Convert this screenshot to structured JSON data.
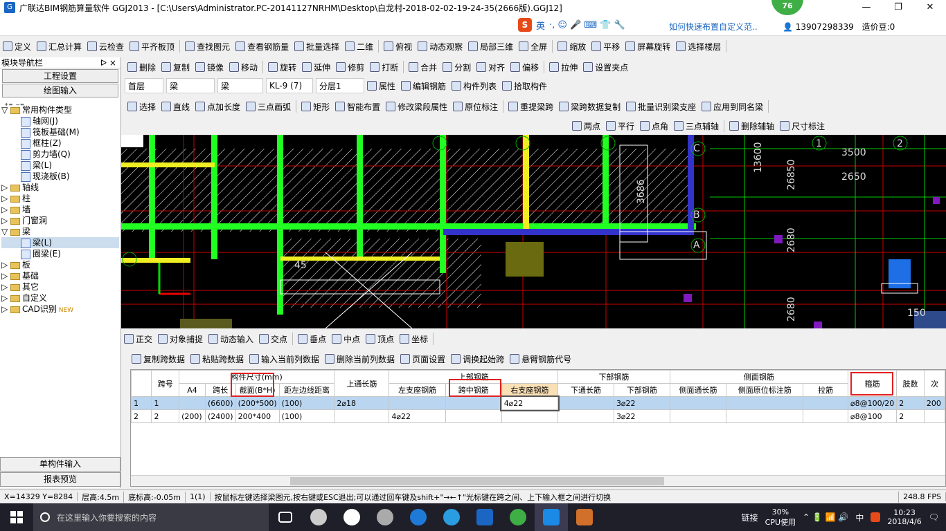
{
  "window": {
    "app_icon": "G",
    "title": "广联达BIM钢筋算量软件 GGJ2013 - [C:\\Users\\Administrator.PC-20141127NRHM\\Desktop\\白龙村-2018-02-02-19-24-35(2666版).GGJ12]",
    "badge": "76",
    "min": "—",
    "max": "❐",
    "close": "✕"
  },
  "ime": {
    "logo": "S",
    "lang": "英",
    "sym": "·, ☺ 🎤 ⌨ 👕 🔧"
  },
  "header": {
    "help_link": "如何快速布置自定义范..",
    "phone": "13907298339",
    "price": "造价豆:0"
  },
  "toolbar1": [
    "定义",
    "汇总计算",
    "云检查",
    "平齐板顶",
    "查找图元",
    "查看钢筋量",
    "批量选择",
    "二维",
    "俯视",
    "动态观察",
    "局部三维",
    "全屏",
    "缩放",
    "平移",
    "屏幕旋转",
    "选择楼层"
  ],
  "toolbar2": [
    "删除",
    "复制",
    "镜像",
    "移动",
    "旋转",
    "延伸",
    "修剪",
    "打断",
    "合并",
    "分割",
    "对齐",
    "偏移",
    "拉伸",
    "设置夹点"
  ],
  "toolbar3": {
    "floor": "首层",
    "cat": "梁",
    "type": "梁",
    "name": "KL-9 (7)",
    "layer": "分层1",
    "btns": [
      "属性",
      "编辑钢筋",
      "构件列表",
      "拾取构件"
    ]
  },
  "toolbar4": [
    "选择",
    "直线",
    "点加长度",
    "三点画弧",
    "矩形",
    "智能布置",
    "修改梁段属性",
    "原位标注",
    "重提梁跨",
    "梁跨数据复制",
    "批量识别梁支座",
    "应用到同名梁"
  ],
  "toolbar5": [
    "两点",
    "平行",
    "点角",
    "三点辅轴",
    "删除辅轴",
    "尺寸标注"
  ],
  "leftpanel": {
    "title": "模块导航栏",
    "pin": "ᐅ ×",
    "btn1": "工程设置",
    "btn2": "绘图输入",
    "tree": [
      {
        "label": "常用构件类型",
        "level": 0,
        "folder": true,
        "exp": "▽"
      },
      {
        "label": "轴网(J)",
        "level": 1
      },
      {
        "label": "筏板基础(M)",
        "level": 1
      },
      {
        "label": "框柱(Z)",
        "level": 1
      },
      {
        "label": "剪力墙(Q)",
        "level": 1
      },
      {
        "label": "梁(L)",
        "level": 1
      },
      {
        "label": "现浇板(B)",
        "level": 1
      },
      {
        "label": "轴线",
        "level": 0,
        "folder": true,
        "exp": "▷"
      },
      {
        "label": "柱",
        "level": 0,
        "folder": true,
        "exp": "▷"
      },
      {
        "label": "墙",
        "level": 0,
        "folder": true,
        "exp": "▷"
      },
      {
        "label": "门窗洞",
        "level": 0,
        "folder": true,
        "exp": "▷"
      },
      {
        "label": "梁",
        "level": 0,
        "folder": true,
        "exp": "▽"
      },
      {
        "label": "梁(L)",
        "level": 1,
        "selected": true
      },
      {
        "label": "圈梁(E)",
        "level": 1
      },
      {
        "label": "板",
        "level": 0,
        "folder": true,
        "exp": "▷"
      },
      {
        "label": "基础",
        "level": 0,
        "folder": true,
        "exp": "▷"
      },
      {
        "label": "其它",
        "level": 0,
        "folder": true,
        "exp": "▷"
      },
      {
        "label": "自定义",
        "level": 0,
        "folder": true,
        "exp": "▷"
      },
      {
        "label": "CAD识别",
        "level": 0,
        "folder": true,
        "exp": "▷",
        "new": "NEW"
      }
    ],
    "btn3": "单构件输入",
    "btn4": "报表预览"
  },
  "canvas_labels": {
    "dim1": "13600",
    "dim2": "3686",
    "dim3": "26850",
    "dim4": "3500",
    "dim5": "2650",
    "angle": "45",
    "num150": "150",
    "axisC": "C",
    "axisB": "B",
    "axisA": "A",
    "axis1": "1",
    "axis2": "2",
    "vtext1": "2680",
    "vtext2": "2680"
  },
  "snapbar": [
    "正交",
    "对象捕捉",
    "动态输入",
    "交点",
    "垂点",
    "中点",
    "顶点",
    "坐标"
  ],
  "gridbar": [
    "复制跨数据",
    "粘贴跨数据",
    "输入当前列数据",
    "删除当前列数据",
    "页面设置",
    "调换起始跨",
    "悬臂钢筋代号"
  ],
  "grid": {
    "h_span": "跨号",
    "h_size": "构件尺寸(mm)",
    "h_upper": "上通长筋",
    "h_top": "上部钢筋",
    "h_bottom": "下部钢筋",
    "h_side": "侧面钢筋",
    "h_stirrup": "箍筋",
    "h_legs": "肢数",
    "h_next": "次",
    "sub": [
      "A4",
      "跨长",
      "截面(B*H)",
      "距左边线距离",
      "左支座钢筋",
      "跨中钢筋",
      "右支座钢筋",
      "下通长筋",
      "下部钢筋",
      "侧面通长筋",
      "侧面原位标注筋",
      "拉筋"
    ],
    "rows": [
      {
        "n": "1",
        "span": "1",
        "a4": "",
        "len": "(6600)",
        "sec": "(200*500)",
        "dist": "(100)",
        "upper": "2⌀18",
        "left": "",
        "mid": "",
        "right": "4⌀22",
        "low": "",
        "lowbar": "3⌀22",
        "side": "",
        "sideo": "",
        "tie": "",
        "stir": "⌀8@100/20",
        "legs": "2",
        "next": "200"
      },
      {
        "n": "2",
        "span": "2",
        "a4": "(200)",
        "len": "(2400)",
        "sec": "200*400",
        "dist": "(100)",
        "upper": "",
        "left": "4⌀22",
        "mid": "",
        "right": "",
        "low": "",
        "lowbar": "3⌀22",
        "side": "",
        "sideo": "",
        "tie": "",
        "stir": "⌀8@100",
        "legs": "2",
        "next": ""
      }
    ]
  },
  "status": [
    "X=14329 Y=8284",
    "层高:4.5m",
    "底标高:-0.05m",
    "1(1)",
    "按鼠标左键选择梁图元,按右键或ESC退出;可以通过回车键及shift+\"→←↑\"光标键在跨之间、上下输入框之间进行切换",
    "248.8 FPS"
  ],
  "taskbar": {
    "search": "在这里输入你要搜索的内容",
    "tray_link": "链接",
    "cpu": "30%",
    "cpu_label": "CPU使用",
    "lang": "中",
    "time": "10:23",
    "date": "2018/4/6"
  }
}
